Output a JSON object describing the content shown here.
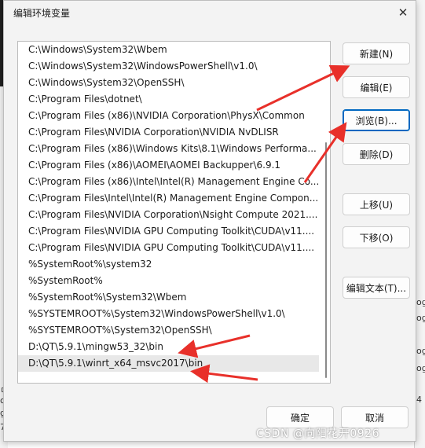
{
  "dialog": {
    "title": "编辑环境变量",
    "close_symbol": "✕"
  },
  "path_list": [
    "C:\\Windows\\System32\\Wbem",
    "C:\\Windows\\System32\\WindowsPowerShell\\v1.0\\",
    "C:\\Windows\\System32\\OpenSSH\\",
    "C:\\Program Files\\dotnet\\",
    "C:\\Program Files (x86)\\NVIDIA Corporation\\PhysX\\Common",
    "C:\\Program Files\\NVIDIA Corporation\\NVIDIA NvDLISR",
    "C:\\Program Files (x86)\\Windows Kits\\8.1\\Windows Performa...",
    "C:\\Program Files (x86)\\AOMEI\\AOMEI Backupper\\6.9.1",
    "C:\\Program Files (x86)\\Intel\\Intel(R) Management Engine Co...",
    "C:\\Program Files\\Intel\\Intel(R) Management Engine Compon...",
    "C:\\Program Files\\NVIDIA Corporation\\Nsight Compute 2021....",
    "C:\\Program Files\\NVIDIA GPU Computing Toolkit\\CUDA\\v11....",
    "C:\\Program Files\\NVIDIA GPU Computing Toolkit\\CUDA\\v11....",
    "%SystemRoot%\\system32",
    "%SystemRoot%",
    "%SystemRoot%\\System32\\Wbem",
    "%SYSTEMROOT%\\System32\\WindowsPowerShell\\v1.0\\",
    "%SYSTEMROOT%\\System32\\OpenSSH\\",
    "D:\\QT\\5.9.1\\mingw53_32\\bin",
    "D:\\QT\\5.9.1\\winrt_x64_msvc2017\\bin"
  ],
  "selected_index": 19,
  "buttons": {
    "new": "新建(N)",
    "edit": "编辑(E)",
    "browse": "浏览(B)...",
    "delete": "删除(D)",
    "move_up": "上移(U)",
    "move_down": "下移(O)",
    "edit_text": "编辑文本(T)...",
    "ok": "确定",
    "cancel": "取消"
  },
  "watermark": "CSDN @向阳花开0926",
  "background_fragments": {
    "right": [
      "og",
      "og",
      "og",
      "og",
      "4"
    ],
    "left": [
      "ㅁ",
      "c",
      "g",
      "7"
    ]
  },
  "colors": {
    "dialog_bg": "#f3f3f3",
    "list_bg": "#ffffff",
    "selected_row": "#e8e8e8",
    "focus_border": "#0067c0",
    "annotation_arrow": "#e8302a"
  }
}
